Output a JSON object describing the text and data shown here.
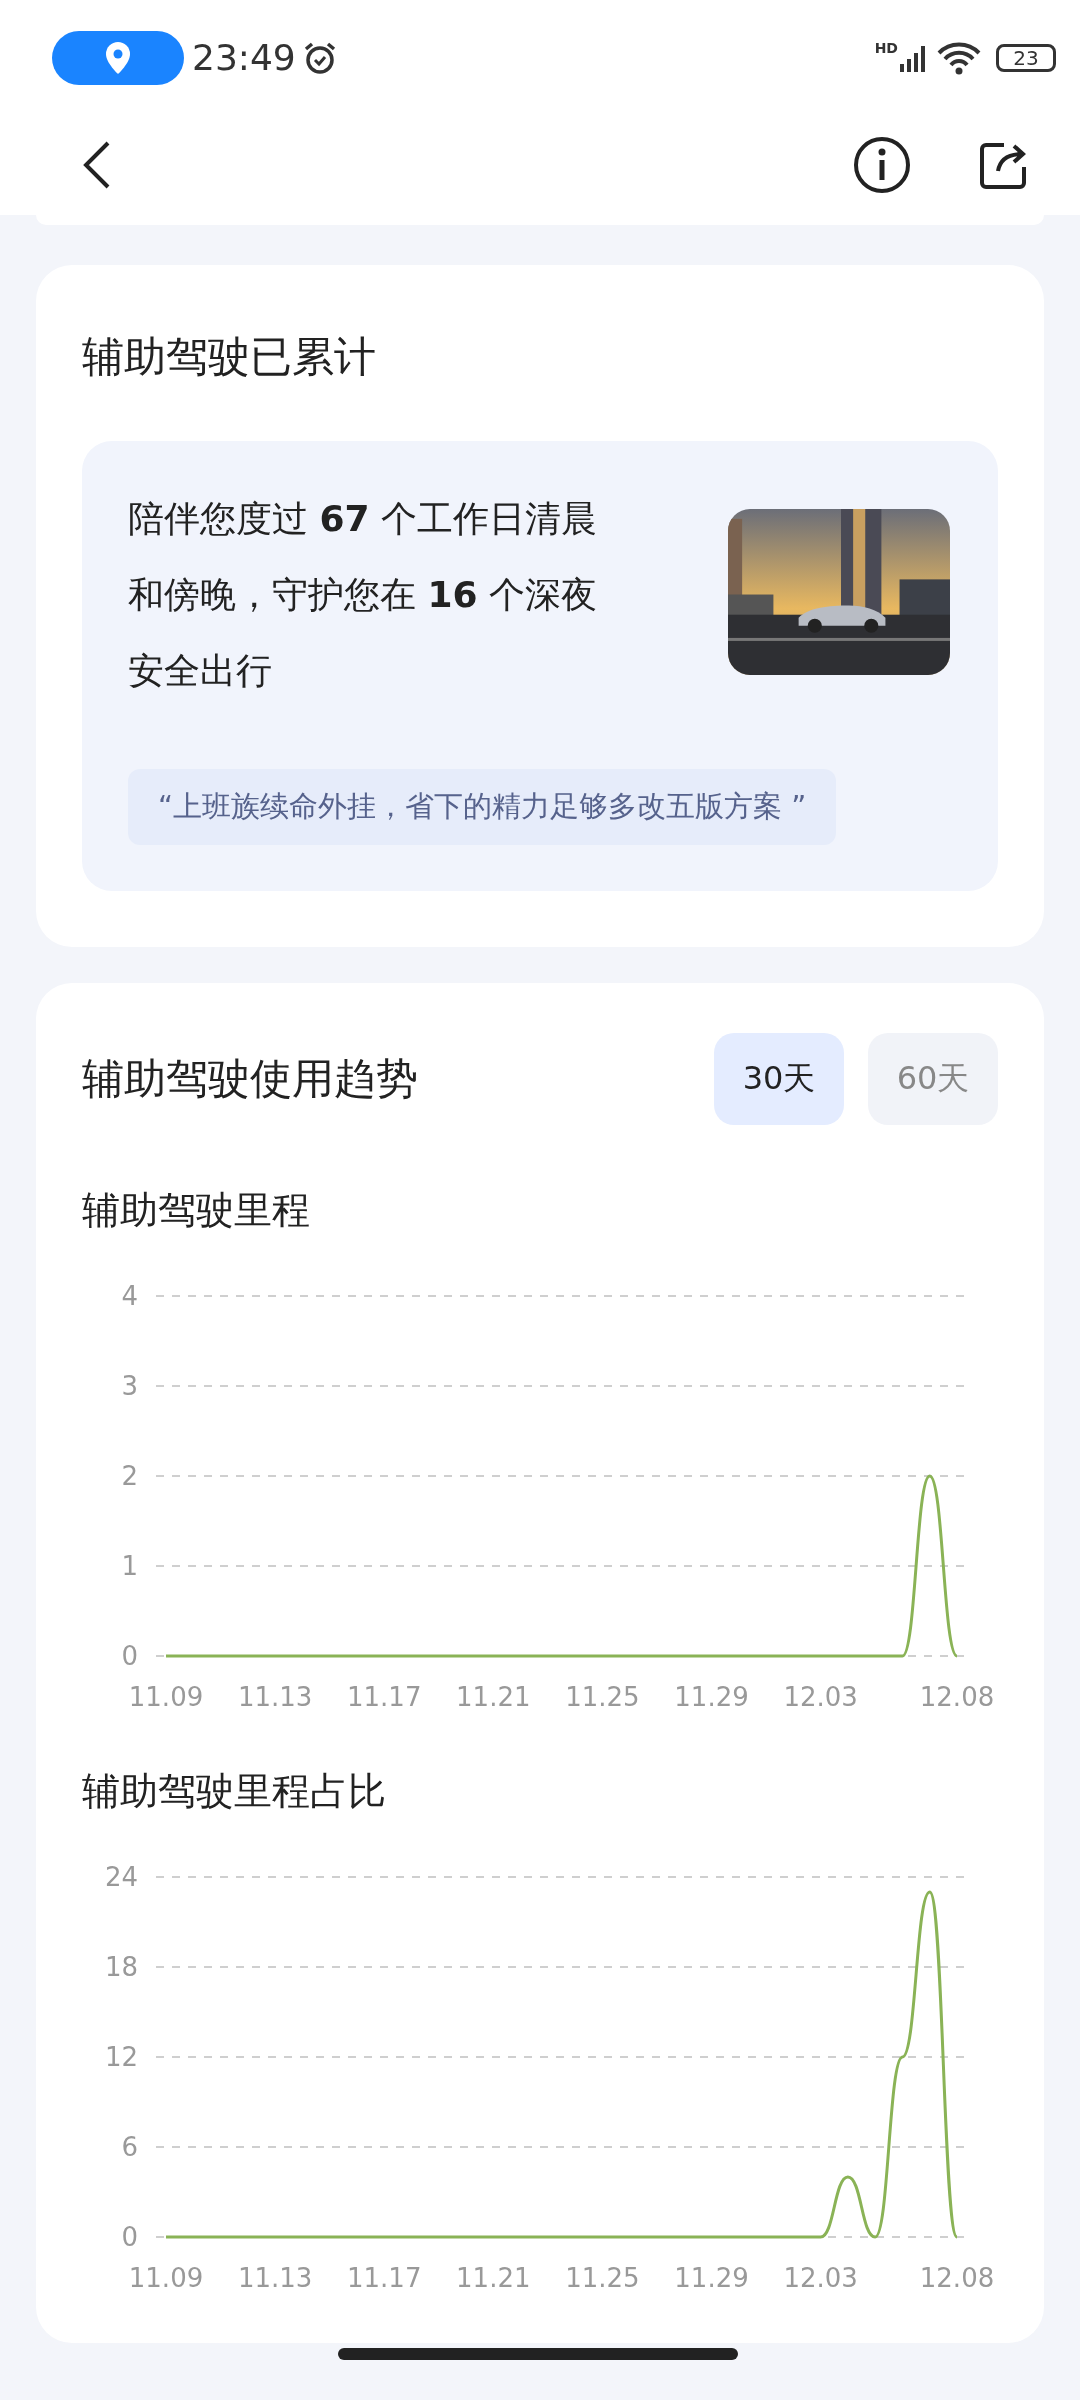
{
  "status_bar": {
    "time": "23:49",
    "network": "HD",
    "battery": "23"
  },
  "summary_card": {
    "title": "辅助驾驶已累计",
    "message": "陪伴您度过 **67** 个工作日清晨和傍晚，守护您在 **16** 个深夜安全出行",
    "quote": "“上班族续命外挂，省下的精力足够多改五版方案 ”"
  },
  "trend_card": {
    "title": "辅助驾驶使用趋势",
    "tabs": [
      {
        "label": "30天",
        "selected": true
      },
      {
        "label": "60天",
        "selected": false
      }
    ],
    "charts": [
      {
        "title": "辅助驾驶里程",
        "chart_data": {
          "type": "line",
          "grid": true,
          "categories": [
            "11.09",
            null,
            null,
            null,
            "11.13",
            null,
            null,
            null,
            "11.17",
            null,
            null,
            null,
            "11.21",
            null,
            null,
            null,
            "11.25",
            null,
            null,
            null,
            "11.29",
            null,
            null,
            null,
            "12.03",
            null,
            null,
            null,
            null,
            "12.08"
          ],
          "series": [
            {
              "color": "#8ab356",
              "values": [
                0,
                0,
                0,
                0,
                0,
                0,
                0,
                0,
                0,
                0,
                0,
                0,
                0,
                0,
                0,
                0,
                0,
                0,
                0,
                0,
                0,
                0,
                0,
                0,
                0,
                0,
                0,
                0,
                2,
                0
              ]
            }
          ],
          "ylim": [
            0,
            4
          ],
          "yticks": [
            0,
            1,
            2,
            3,
            4
          ]
        }
      },
      {
        "title": "辅助驾驶里程占比",
        "chart_data": {
          "type": "line",
          "grid": true,
          "categories": [
            "11.09",
            null,
            null,
            null,
            "11.13",
            null,
            null,
            null,
            "11.17",
            null,
            null,
            null,
            "11.21",
            null,
            null,
            null,
            "11.25",
            null,
            null,
            null,
            "11.29",
            null,
            null,
            null,
            "12.03",
            null,
            null,
            null,
            null,
            "12.08"
          ],
          "series": [
            {
              "color": "#8ab356",
              "values": [
                0,
                0,
                0,
                0,
                0,
                0,
                0,
                0,
                0,
                0,
                0,
                0,
                0,
                0,
                0,
                0,
                0,
                0,
                0,
                0,
                0,
                0,
                0,
                0,
                0,
                4,
                0,
                12,
                23,
                0
              ]
            }
          ],
          "ylim": [
            0,
            24
          ],
          "yticks": [
            0,
            6,
            12,
            18,
            24
          ]
        }
      }
    ]
  }
}
